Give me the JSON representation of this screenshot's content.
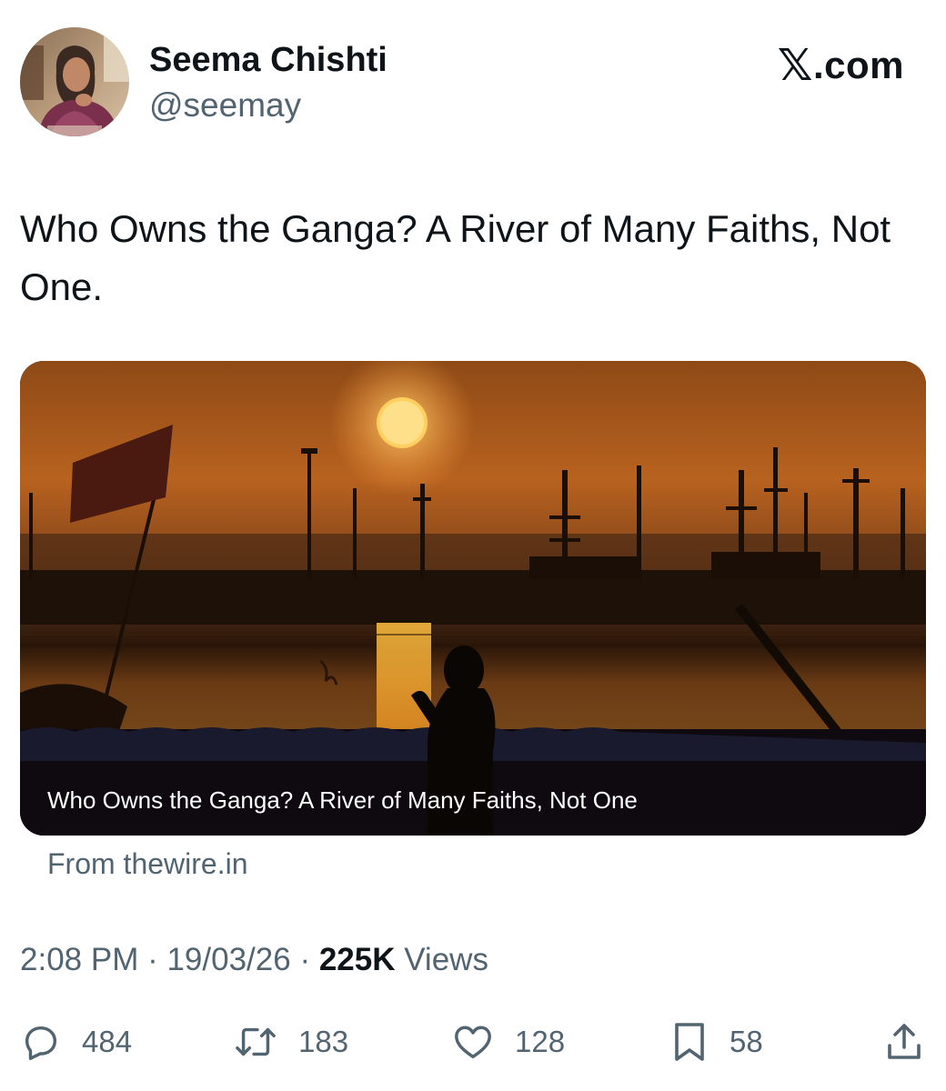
{
  "author": {
    "name": "Seema Chishti",
    "handle": "@seemay"
  },
  "brand": {
    "x_glyph": "𝕏",
    "suffix": ".com"
  },
  "tweet": {
    "text": "Who Owns the Ganga? A River of Many Faiths, Not One."
  },
  "card": {
    "caption": "Who Owns the Ganga? A River of Many Faiths, Not One",
    "source": "From thewire.in"
  },
  "meta": {
    "time": "2:08 PM",
    "separator": " · ",
    "date": "19/03/26",
    "views_count": "225K",
    "views_label": " Views"
  },
  "actions": {
    "reply": {
      "icon": "reply-icon",
      "count": "484"
    },
    "retweet": {
      "icon": "retweet-icon",
      "count": "183"
    },
    "like": {
      "icon": "heart-icon",
      "count": "128"
    },
    "bookmark": {
      "icon": "bookmark-icon",
      "count": "58"
    },
    "share": {
      "icon": "share-icon"
    }
  },
  "colors": {
    "text_primary": "#0f1419",
    "text_secondary": "#536471",
    "sunset_orange": "#e08a2c"
  }
}
